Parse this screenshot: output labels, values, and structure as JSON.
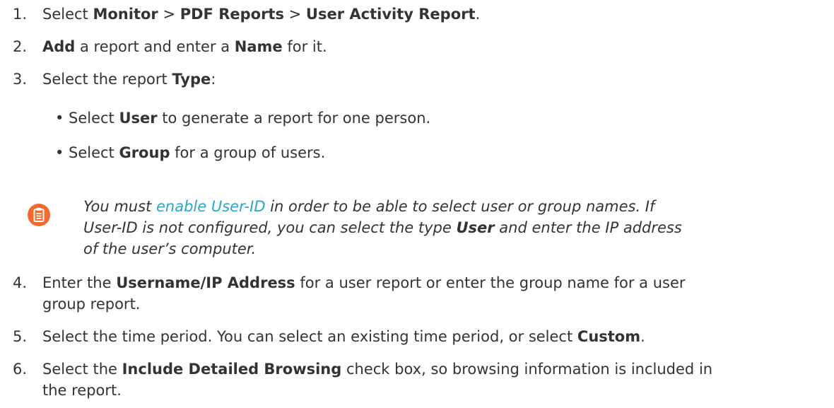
{
  "steps": [
    {
      "num": "1.",
      "parts": [
        "Select ",
        "Monitor",
        " > ",
        "PDF Reports",
        " > ",
        "User Activity Report",
        "."
      ]
    },
    {
      "num": "2.",
      "parts": [
        "Add",
        " a report and enter a ",
        "Name",
        " for it."
      ]
    },
    {
      "num": "3.",
      "parts": [
        "Select the report ",
        "Type",
        ":"
      ]
    },
    {
      "num": "4.",
      "parts": [
        "Enter the ",
        "Username/IP Address",
        " for a user report or enter the group name for a user"
      ],
      "line2": "group report."
    },
    {
      "num": "5.",
      "parts": [
        "Select the time period. You can select an existing time period, or select ",
        "Custom",
        "."
      ]
    },
    {
      "num": "6.",
      "parts": [
        "Select the ",
        "Include Detailed Browsing",
        " check box, so browsing information is included in"
      ],
      "line2": "the report."
    }
  ],
  "bullets": [
    {
      "glyph": "•",
      "parts": [
        "Select ",
        "User",
        " to generate a report for one person."
      ]
    },
    {
      "glyph": "•",
      "parts": [
        "Select ",
        "Group",
        " for a group of users."
      ]
    }
  ],
  "note": {
    "icon": "clipboard-note-icon",
    "icon_color": "#f26a2e",
    "lead": "You must ",
    "link": "enable User-ID",
    "after_link": " in order to be able to select user or group names. If",
    "line2": "User-ID is not configured, you can select the type ",
    "line2_bold": "User",
    "line2_after": " and enter the IP address",
    "line3": "of the user’s computer."
  }
}
